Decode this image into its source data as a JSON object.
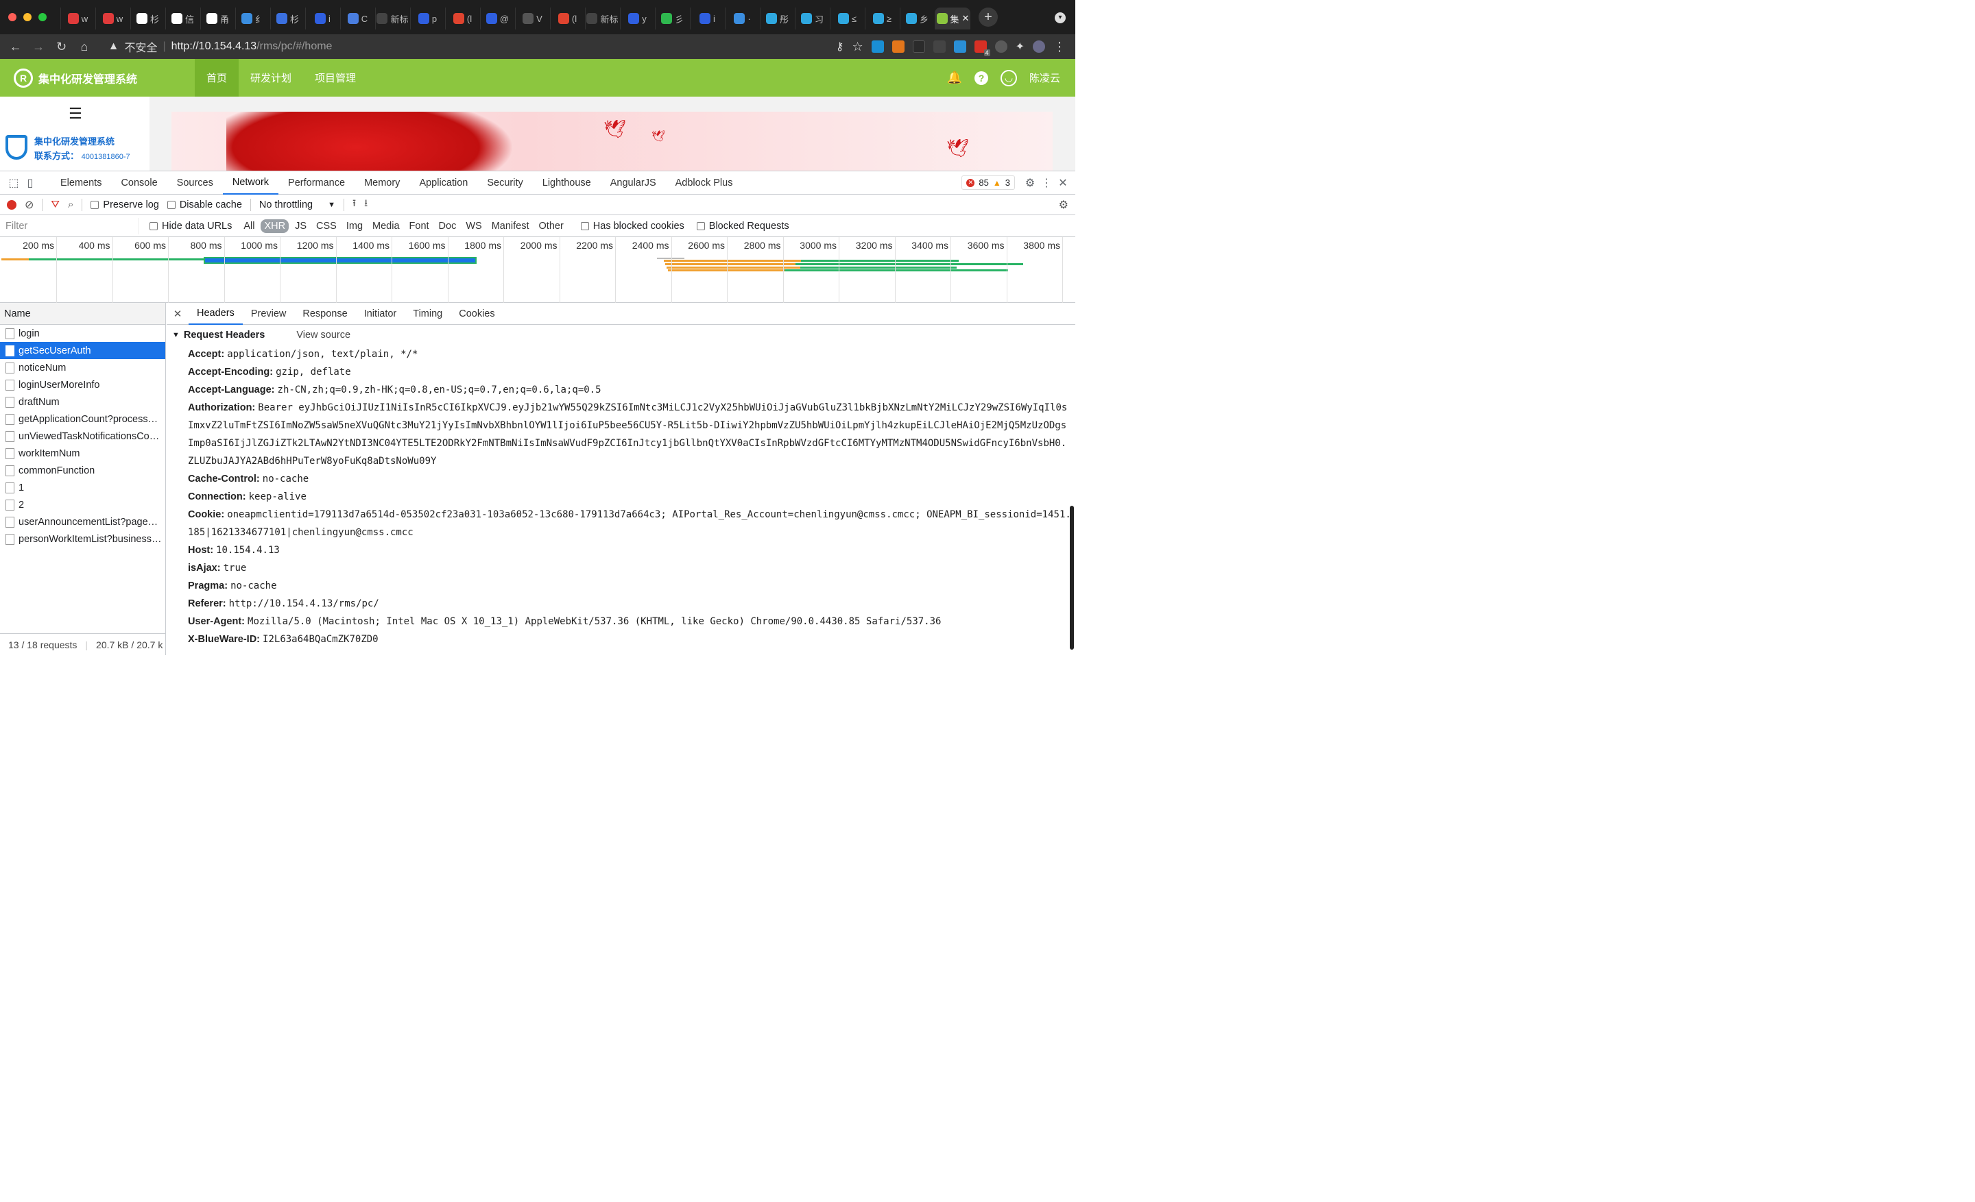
{
  "browser": {
    "tabs": [
      {
        "label": "w",
        "color": "#e03b3b"
      },
      {
        "label": "w",
        "color": "#e03b3b"
      },
      {
        "label": "杉",
        "color": "#ffffff"
      },
      {
        "label": "信",
        "color": "#ffffff"
      },
      {
        "label": "甬",
        "color": "#ffffff"
      },
      {
        "label": "纟",
        "color": "#3b8ee0"
      },
      {
        "label": "杉",
        "color": "#3b70e0"
      },
      {
        "label": "i",
        "color": "#2f5fe0"
      },
      {
        "label": "C",
        "color": "#4a7ee0"
      },
      {
        "label": "新标",
        "color": "#444444"
      },
      {
        "label": "p",
        "color": "#2f5fe0"
      },
      {
        "label": "(l",
        "color": "#e0442f"
      },
      {
        "label": "@",
        "color": "#2f5fe0"
      },
      {
        "label": "V",
        "color": "#555555"
      },
      {
        "label": "(l",
        "color": "#e0442f"
      },
      {
        "label": "新标",
        "color": "#444444"
      },
      {
        "label": "y",
        "color": "#2f5fe0"
      },
      {
        "label": "彡",
        "color": "#2fb84f"
      },
      {
        "label": "i",
        "color": "#2f5fe0"
      },
      {
        "label": "·",
        "color": "#3b8ee0"
      },
      {
        "label": "彤",
        "color": "#2fa8e0"
      },
      {
        "label": "习",
        "color": "#2fa8e0"
      },
      {
        "label": "≤",
        "color": "#2fa8e0"
      },
      {
        "label": "≥",
        "color": "#2fa8e0"
      },
      {
        "label": "乡",
        "color": "#2fa8e0"
      },
      {
        "label": "集",
        "color": "#8cc63f"
      }
    ],
    "active_tab_close": "✕",
    "new_tab": "+",
    "security_label": "不安全",
    "url_host": "http://10.154.4.13",
    "url_path": "/rms/pc/#/home",
    "ext_badge": "4"
  },
  "app": {
    "title": "集中化研发管理系统",
    "nav": [
      "首页",
      "研发计划",
      "项目管理"
    ],
    "user": "陈凌云",
    "side_title": "集中化研发管理系统",
    "side_contact_label": "联系方式：",
    "side_contact_value": "4001381860-7",
    "accent": "#8cc63f"
  },
  "devtools": {
    "tabs": [
      "Elements",
      "Console",
      "Sources",
      "Network",
      "Performance",
      "Memory",
      "Application",
      "Security",
      "Lighthouse",
      "AngularJS",
      "Adblock Plus"
    ],
    "active_tab": "Network",
    "error_count": "85",
    "warning_count": "3",
    "toolbar": {
      "preserve_log": "Preserve log",
      "disable_cache": "Disable cache",
      "throttling": "No throttling"
    },
    "filter": {
      "placeholder": "Filter",
      "hide_data_urls": "Hide data URLs",
      "types": [
        "All",
        "XHR",
        "JS",
        "CSS",
        "Img",
        "Media",
        "Font",
        "Doc",
        "WS",
        "Manifest",
        "Other"
      ],
      "active_type": "XHR",
      "has_blocked_cookies": "Has blocked cookies",
      "blocked_requests": "Blocked Requests"
    },
    "timeline_ticks": [
      "200 ms",
      "400 ms",
      "600 ms",
      "800 ms",
      "1000 ms",
      "1200 ms",
      "1400 ms",
      "1600 ms",
      "1800 ms",
      "2000 ms",
      "2200 ms",
      "2400 ms",
      "2600 ms",
      "2800 ms",
      "3000 ms",
      "3200 ms",
      "3400 ms",
      "3600 ms",
      "3800 ms"
    ],
    "name_header": "Name",
    "requests": [
      "login",
      "getSecUserAuth",
      "noticeNum",
      "loginUserMoreInfo",
      "draftNum",
      "getApplicationCount?process…",
      "unViewedTaskNotificationsCo…",
      "workItemNum",
      "commonFunction",
      "1",
      "2",
      "userAnnouncementList?page…",
      "personWorkItemList?business…"
    ],
    "selected_request": "getSecUserAuth",
    "status_requests": "13 / 18 requests",
    "status_size": "20.7 kB / 20.7 k",
    "detail_tabs": [
      "Headers",
      "Preview",
      "Response",
      "Initiator",
      "Timing",
      "Cookies"
    ],
    "active_detail_tab": "Headers",
    "section_title": "Request Headers",
    "view_source": "View source",
    "headers": [
      {
        "name": "Accept:",
        "value": "application/json, text/plain, */*"
      },
      {
        "name": "Accept-Encoding:",
        "value": "gzip, deflate"
      },
      {
        "name": "Accept-Language:",
        "value": "zh-CN,zh;q=0.9,zh-HK;q=0.8,en-US;q=0.7,en;q=0.6,la;q=0.5"
      },
      {
        "name": "Authorization:",
        "value": "Bearer eyJhbGciOiJIUzI1NiIsInR5cCI6IkpXVCJ9.eyJjb21wYW55Q29kZSI6ImNtc3MiLCJ1c2VyX25hbWUiOiJjaGVubGluZ3l1bkBjbXNzLmNtY2MiLCJzY29wZSI6WyIqIl0sImxvZ2luTmFtZSI6ImNoZW5saW5neXVuQGNtc3MuY21jYyIsImNvbXBhbnlOYW1lIjoi6IuP5bee56CU5Y-R5Lit5b-DIiwiY2hpbmVzZU5hbWUiOiLpmYjlh4zkupEiLCJleHAiOjE2MjQ5MzUzODgsImp0aSI6IjJlZGJiZTk2LTAwN2YtNDI3NC04YTE5LTE2ODRkY2FmNTBmNiIsImNsaWVudF9pZCI6InJtcy1jbGllbnQtYXV0aCIsInRpbWVzdGFtcCI6MTYyMTMzNTM4ODU5NSwidGFncyI6bnVsbH0.ZLUZbuJAJYA2ABd6hHPuTerW8yoFuKq8aDtsNoWu09Y"
      },
      {
        "name": "Cache-Control:",
        "value": "no-cache"
      },
      {
        "name": "Connection:",
        "value": "keep-alive"
      },
      {
        "name": "Cookie:",
        "value": "oneapmclientid=179113d7a6514d-053502cf23a031-103a6052-13c680-179113d7a664c3; AIPortal_Res_Account=chenlingyun@cmss.cmcc; ONEAPM_BI_sessionid=1451.185|1621334677101|chenlingyun@cmss.cmcc"
      },
      {
        "name": "Host:",
        "value": "10.154.4.13"
      },
      {
        "name": "isAjax:",
        "value": "true"
      },
      {
        "name": "Pragma:",
        "value": "no-cache"
      },
      {
        "name": "Referer:",
        "value": "http://10.154.4.13/rms/pc/"
      },
      {
        "name": "User-Agent:",
        "value": "Mozilla/5.0 (Macintosh; Intel Mac OS X 10_13_1) AppleWebKit/537.36 (KHTML, like Gecko) Chrome/90.0.4430.85 Safari/537.36"
      },
      {
        "name": "X-BlueWare-ID:",
        "value": "I2L63a64BQaCmZK70ZD0"
      }
    ]
  }
}
